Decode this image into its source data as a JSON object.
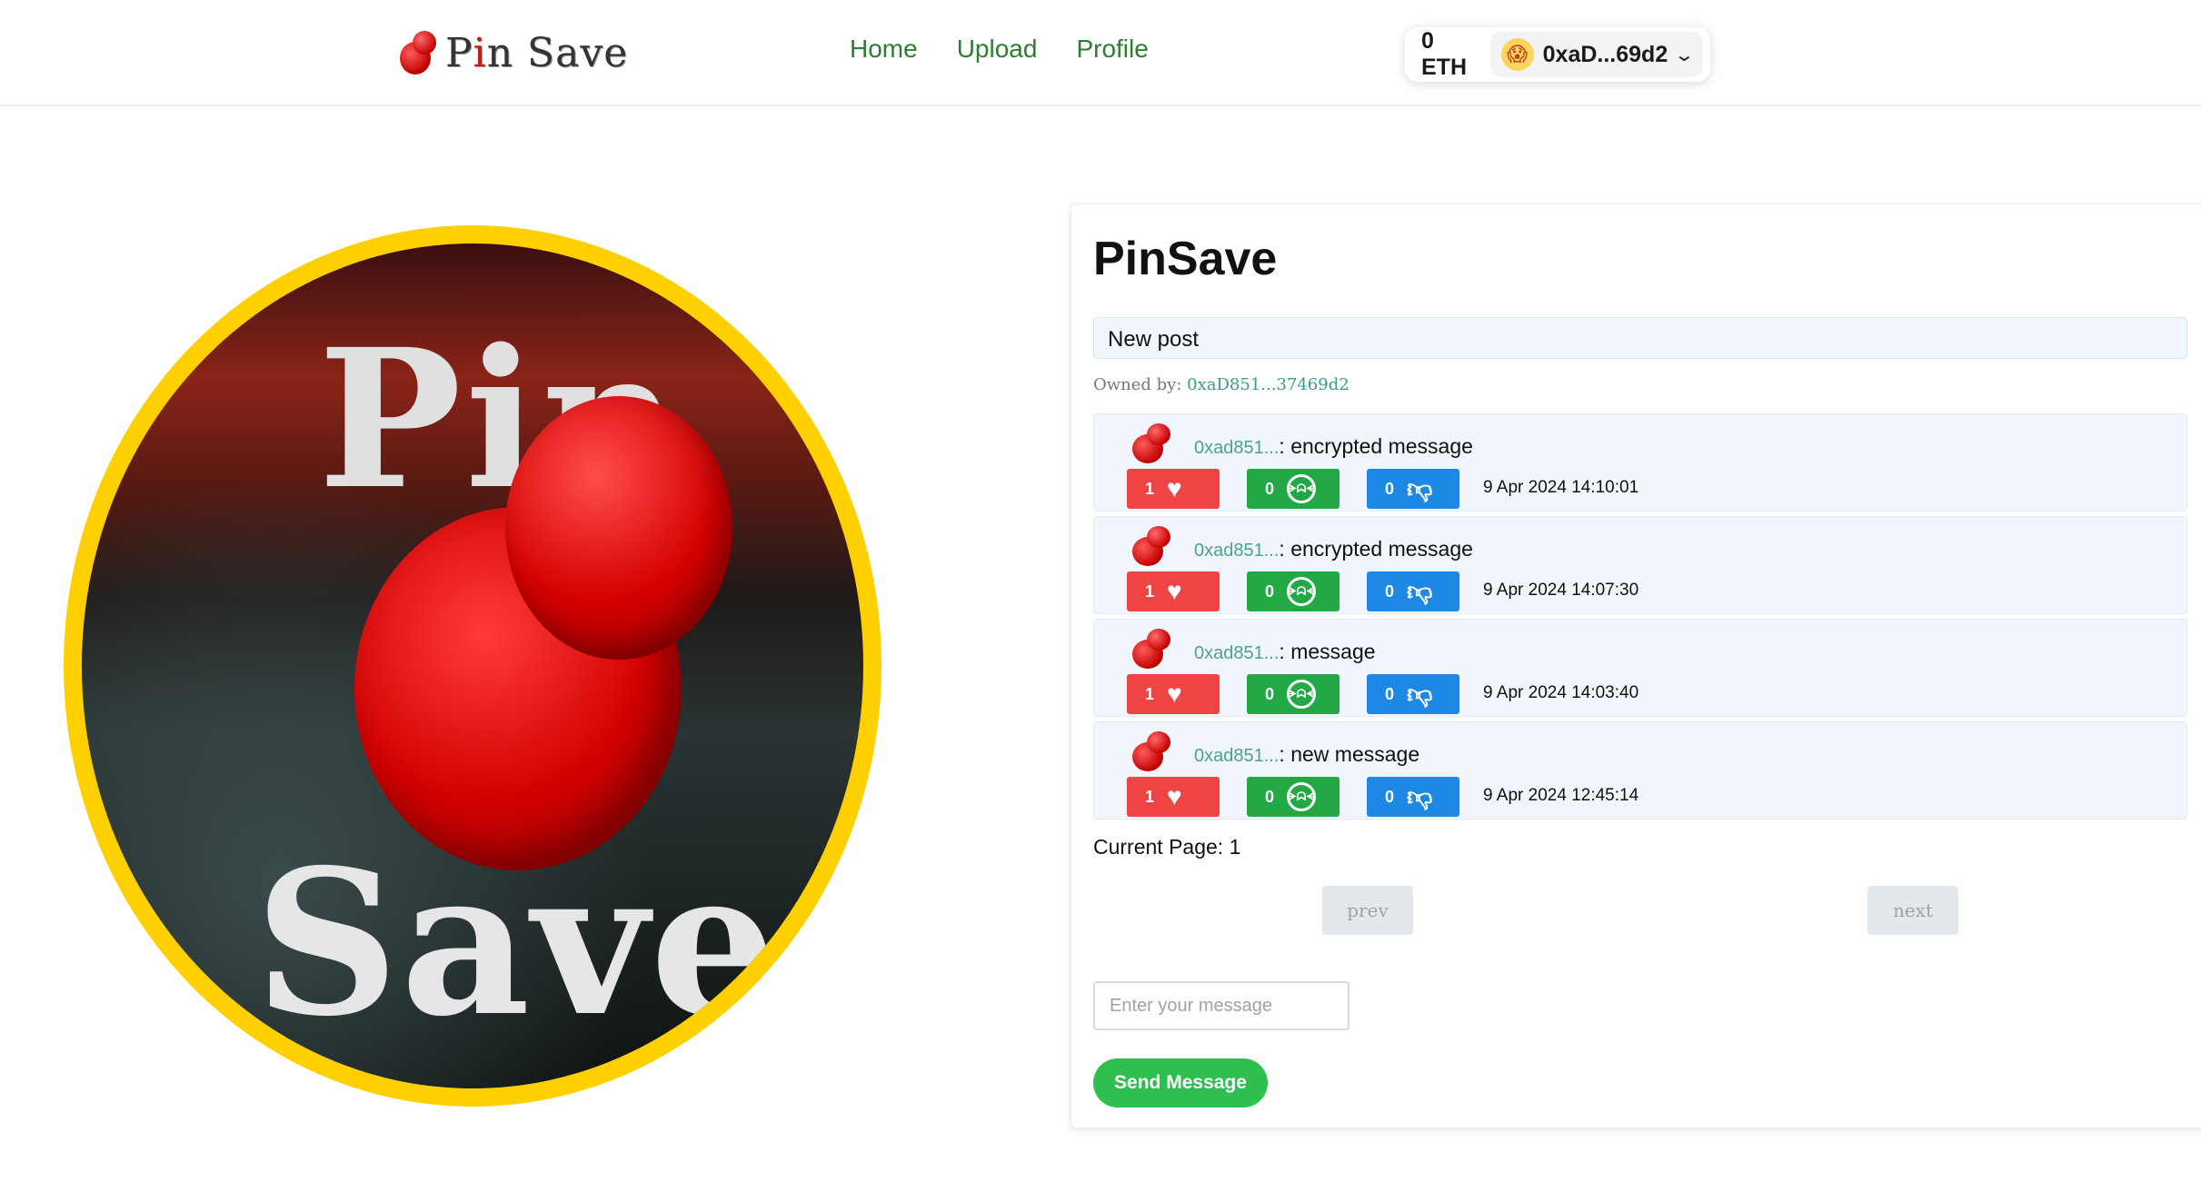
{
  "header": {
    "logo_text_p": "P",
    "logo_text_i": "i",
    "logo_text_rest": "n Save",
    "nav": [
      "Home",
      "Upload",
      "Profile"
    ],
    "balance": "0 ETH",
    "account": "0xaD...69d2",
    "avatar_emoji": "😱"
  },
  "hero": {
    "text_top": "Pin",
    "text_bottom": "Save"
  },
  "post": {
    "title": "PinSave",
    "description": "New post",
    "owned_label": "Owned by:",
    "owner": "0xaD851...37469d2"
  },
  "messages": [
    {
      "sender": "0xad851...",
      "text": ": encrypted message",
      "likes": "1",
      "laughs": "0",
      "dislikes": "0",
      "time": "9 Apr 2024 14:10:01"
    },
    {
      "sender": "0xad851...",
      "text": ": encrypted message",
      "likes": "1",
      "laughs": "0",
      "dislikes": "0",
      "time": "9 Apr 2024 14:07:30"
    },
    {
      "sender": "0xad851...",
      "text": ": message",
      "likes": "1",
      "laughs": "0",
      "dislikes": "0",
      "time": "9 Apr 2024 14:03:40"
    },
    {
      "sender": "0xad851...",
      "text": ": new message",
      "likes": "1",
      "laughs": "0",
      "dislikes": "0",
      "time": "9 Apr 2024 12:45:14"
    }
  ],
  "pagination": {
    "label": "Current Page: 1",
    "prev": "prev",
    "next": "next"
  },
  "composer": {
    "placeholder": "Enter your message",
    "send": "Send Message"
  },
  "colors": {
    "nav": "#2e7d32",
    "like": "#ef4444",
    "laugh": "#22a844",
    "dislike": "#1e88e5",
    "send": "#2fbf4f",
    "hero_ring": "#ffd000"
  },
  "icons": {
    "like": "heart-icon",
    "laugh": "laughing-face-icon",
    "dislike": "thumbs-down-icon",
    "account_menu": "chevron-down-icon"
  }
}
